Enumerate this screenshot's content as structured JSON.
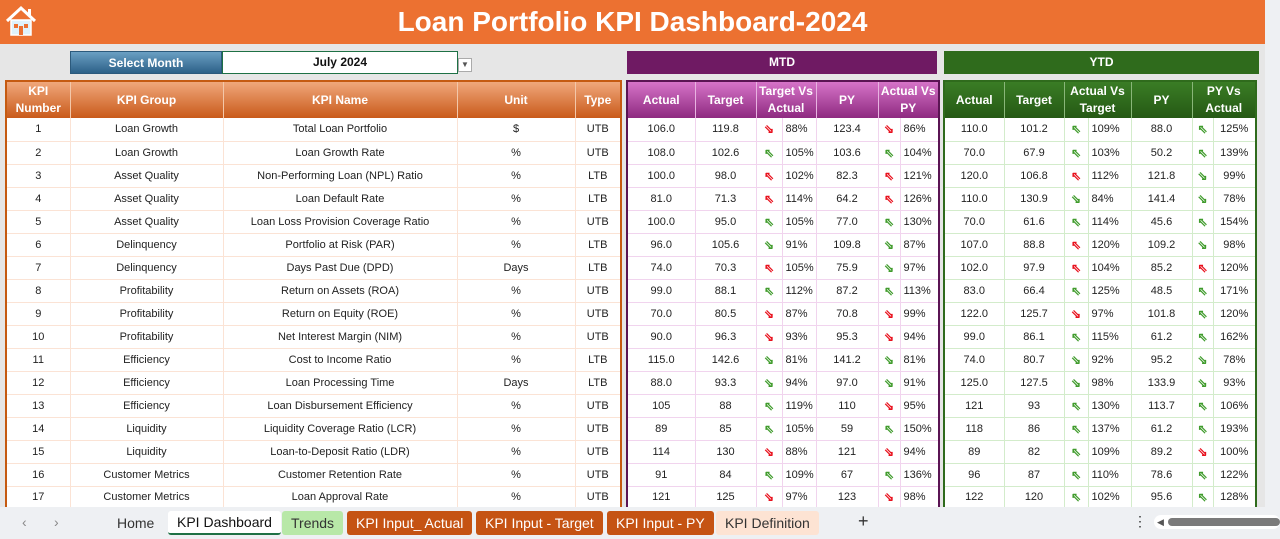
{
  "header": {
    "title": "Loan Portfolio KPI Dashboard-2024",
    "home_icon": "home-icon",
    "brand_color": "#ec7131"
  },
  "selector": {
    "label": "Select Month",
    "value": "July 2024",
    "dropdown_icon": "chevron-down-icon"
  },
  "sections": {
    "mtd": "MTD",
    "ytd": "YTD"
  },
  "kpi_columns": [
    "KPI Number",
    "KPI Group",
    "KPI Name",
    "Unit",
    "Type"
  ],
  "mtd_columns": [
    "Actual",
    "Target",
    "Target Vs Actual",
    "PY",
    "Actual Vs PY"
  ],
  "ytd_columns": [
    "Actual",
    "Target",
    "Actual Vs Target",
    "PY",
    "PY Vs Actual"
  ],
  "status_colors": {
    "good": "#3f9b2b",
    "bad": "#e8101c"
  },
  "rows": [
    {
      "num": "1",
      "group": "Loan Growth",
      "name": "Total Loan Portfolio",
      "unit": "$",
      "type": "UTB",
      "mtd": {
        "actual": "106.0",
        "target": "119.8",
        "tva_dir": "down",
        "tva_status": "bad",
        "tva": "88%",
        "py": "123.4",
        "avp_dir": "down",
        "avp_status": "bad",
        "avp": "86%"
      },
      "ytd": {
        "actual": "110.0",
        "target": "101.2",
        "avt_dir": "up",
        "avt_status": "good",
        "avt": "109%",
        "py": "88.0",
        "pva_dir": "up",
        "pva_status": "good",
        "pva": "125%"
      }
    },
    {
      "num": "2",
      "group": "Loan Growth",
      "name": "Loan Growth Rate",
      "unit": "%",
      "type": "UTB",
      "mtd": {
        "actual": "108.0",
        "target": "102.6",
        "tva_dir": "up",
        "tva_status": "good",
        "tva": "105%",
        "py": "103.6",
        "avp_dir": "up",
        "avp_status": "good",
        "avp": "104%"
      },
      "ytd": {
        "actual": "70.0",
        "target": "67.9",
        "avt_dir": "up",
        "avt_status": "good",
        "avt": "103%",
        "py": "50.2",
        "pva_dir": "up",
        "pva_status": "good",
        "pva": "139%"
      }
    },
    {
      "num": "3",
      "group": "Asset Quality",
      "name": "Non-Performing Loan (NPL) Ratio",
      "unit": "%",
      "type": "LTB",
      "mtd": {
        "actual": "100.0",
        "target": "98.0",
        "tva_dir": "up",
        "tva_status": "bad",
        "tva": "102%",
        "py": "82.3",
        "avp_dir": "up",
        "avp_status": "bad",
        "avp": "121%"
      },
      "ytd": {
        "actual": "120.0",
        "target": "106.8",
        "avt_dir": "up",
        "avt_status": "bad",
        "avt": "112%",
        "py": "121.8",
        "pva_dir": "down",
        "pva_status": "good",
        "pva": "99%"
      }
    },
    {
      "num": "4",
      "group": "Asset Quality",
      "name": "Loan Default Rate",
      "unit": "%",
      "type": "LTB",
      "mtd": {
        "actual": "81.0",
        "target": "71.3",
        "tva_dir": "up",
        "tva_status": "bad",
        "tva": "114%",
        "py": "64.2",
        "avp_dir": "up",
        "avp_status": "bad",
        "avp": "126%"
      },
      "ytd": {
        "actual": "110.0",
        "target": "130.9",
        "avt_dir": "down",
        "avt_status": "good",
        "avt": "84%",
        "py": "141.4",
        "pva_dir": "down",
        "pva_status": "good",
        "pva": "78%"
      }
    },
    {
      "num": "5",
      "group": "Asset Quality",
      "name": "Loan Loss Provision Coverage Ratio",
      "unit": "%",
      "type": "UTB",
      "mtd": {
        "actual": "100.0",
        "target": "95.0",
        "tva_dir": "up",
        "tva_status": "good",
        "tva": "105%",
        "py": "77.0",
        "avp_dir": "up",
        "avp_status": "good",
        "avp": "130%"
      },
      "ytd": {
        "actual": "70.0",
        "target": "61.6",
        "avt_dir": "up",
        "avt_status": "good",
        "avt": "114%",
        "py": "45.6",
        "pva_dir": "up",
        "pva_status": "good",
        "pva": "154%"
      }
    },
    {
      "num": "6",
      "group": "Delinquency",
      "name": "Portfolio at Risk (PAR)",
      "unit": "%",
      "type": "LTB",
      "mtd": {
        "actual": "96.0",
        "target": "105.6",
        "tva_dir": "down",
        "tva_status": "good",
        "tva": "91%",
        "py": "109.8",
        "avp_dir": "down",
        "avp_status": "good",
        "avp": "87%"
      },
      "ytd": {
        "actual": "107.0",
        "target": "88.8",
        "avt_dir": "up",
        "avt_status": "bad",
        "avt": "120%",
        "py": "109.2",
        "pva_dir": "down",
        "pva_status": "good",
        "pva": "98%"
      }
    },
    {
      "num": "7",
      "group": "Delinquency",
      "name": "Days Past Due (DPD)",
      "unit": "Days",
      "type": "LTB",
      "mtd": {
        "actual": "74.0",
        "target": "70.3",
        "tva_dir": "up",
        "tva_status": "bad",
        "tva": "105%",
        "py": "75.9",
        "avp_dir": "down",
        "avp_status": "good",
        "avp": "97%"
      },
      "ytd": {
        "actual": "102.0",
        "target": "97.9",
        "avt_dir": "up",
        "avt_status": "bad",
        "avt": "104%",
        "py": "85.2",
        "pva_dir": "up",
        "pva_status": "bad",
        "pva": "120%"
      }
    },
    {
      "num": "8",
      "group": "Profitability",
      "name": "Return on Assets (ROA)",
      "unit": "%",
      "type": "UTB",
      "mtd": {
        "actual": "99.0",
        "target": "88.1",
        "tva_dir": "up",
        "tva_status": "good",
        "tva": "112%",
        "py": "87.2",
        "avp_dir": "up",
        "avp_status": "good",
        "avp": "113%"
      },
      "ytd": {
        "actual": "83.0",
        "target": "66.4",
        "avt_dir": "up",
        "avt_status": "good",
        "avt": "125%",
        "py": "48.5",
        "pva_dir": "up",
        "pva_status": "good",
        "pva": "171%"
      }
    },
    {
      "num": "9",
      "group": "Profitability",
      "name": "Return on Equity (ROE)",
      "unit": "%",
      "type": "UTB",
      "mtd": {
        "actual": "70.0",
        "target": "80.5",
        "tva_dir": "down",
        "tva_status": "bad",
        "tva": "87%",
        "py": "70.8",
        "avp_dir": "down",
        "avp_status": "bad",
        "avp": "99%"
      },
      "ytd": {
        "actual": "122.0",
        "target": "125.7",
        "avt_dir": "down",
        "avt_status": "bad",
        "avt": "97%",
        "py": "101.8",
        "pva_dir": "up",
        "pva_status": "good",
        "pva": "120%"
      }
    },
    {
      "num": "10",
      "group": "Profitability",
      "name": "Net Interest Margin (NIM)",
      "unit": "%",
      "type": "UTB",
      "mtd": {
        "actual": "90.0",
        "target": "96.3",
        "tva_dir": "down",
        "tva_status": "bad",
        "tva": "93%",
        "py": "95.3",
        "avp_dir": "down",
        "avp_status": "bad",
        "avp": "94%"
      },
      "ytd": {
        "actual": "99.0",
        "target": "86.1",
        "avt_dir": "up",
        "avt_status": "good",
        "avt": "115%",
        "py": "61.2",
        "pva_dir": "up",
        "pva_status": "good",
        "pva": "162%"
      }
    },
    {
      "num": "11",
      "group": "Efficiency",
      "name": "Cost to Income Ratio",
      "unit": "%",
      "type": "LTB",
      "mtd": {
        "actual": "115.0",
        "target": "142.6",
        "tva_dir": "down",
        "tva_status": "good",
        "tva": "81%",
        "py": "141.2",
        "avp_dir": "down",
        "avp_status": "good",
        "avp": "81%"
      },
      "ytd": {
        "actual": "74.0",
        "target": "80.7",
        "avt_dir": "down",
        "avt_status": "good",
        "avt": "92%",
        "py": "95.2",
        "pva_dir": "down",
        "pva_status": "good",
        "pva": "78%"
      }
    },
    {
      "num": "12",
      "group": "Efficiency",
      "name": "Loan Processing Time",
      "unit": "Days",
      "type": "LTB",
      "mtd": {
        "actual": "88.0",
        "target": "93.3",
        "tva_dir": "down",
        "tva_status": "good",
        "tva": "94%",
        "py": "97.0",
        "avp_dir": "down",
        "avp_status": "good",
        "avp": "91%"
      },
      "ytd": {
        "actual": "125.0",
        "target": "127.5",
        "avt_dir": "down",
        "avt_status": "good",
        "avt": "98%",
        "py": "133.9",
        "pva_dir": "down",
        "pva_status": "good",
        "pva": "93%"
      }
    },
    {
      "num": "13",
      "group": "Efficiency",
      "name": "Loan Disbursement Efficiency",
      "unit": "%",
      "type": "UTB",
      "mtd": {
        "actual": "105",
        "target": "88",
        "tva_dir": "up",
        "tva_status": "good",
        "tva": "119%",
        "py": "110",
        "avp_dir": "down",
        "avp_status": "bad",
        "avp": "95%"
      },
      "ytd": {
        "actual": "121",
        "target": "93",
        "avt_dir": "up",
        "avt_status": "good",
        "avt": "130%",
        "py": "113.7",
        "pva_dir": "up",
        "pva_status": "good",
        "pva": "106%"
      }
    },
    {
      "num": "14",
      "group": "Liquidity",
      "name": "Liquidity Coverage Ratio (LCR)",
      "unit": "%",
      "type": "UTB",
      "mtd": {
        "actual": "89",
        "target": "85",
        "tva_dir": "up",
        "tva_status": "good",
        "tva": "105%",
        "py": "59",
        "avp_dir": "up",
        "avp_status": "good",
        "avp": "150%"
      },
      "ytd": {
        "actual": "118",
        "target": "86",
        "avt_dir": "up",
        "avt_status": "good",
        "avt": "137%",
        "py": "61.2",
        "pva_dir": "up",
        "pva_status": "good",
        "pva": "193%"
      }
    },
    {
      "num": "15",
      "group": "Liquidity",
      "name": "Loan-to-Deposit Ratio (LDR)",
      "unit": "%",
      "type": "UTB",
      "mtd": {
        "actual": "114",
        "target": "130",
        "tva_dir": "down",
        "tva_status": "bad",
        "tva": "88%",
        "py": "121",
        "avp_dir": "down",
        "avp_status": "bad",
        "avp": "94%"
      },
      "ytd": {
        "actual": "89",
        "target": "82",
        "avt_dir": "up",
        "avt_status": "good",
        "avt": "109%",
        "py": "89.2",
        "pva_dir": "down",
        "pva_status": "bad",
        "pva": "100%"
      }
    },
    {
      "num": "16",
      "group": "Customer Metrics",
      "name": "Customer Retention Rate",
      "unit": "%",
      "type": "UTB",
      "mtd": {
        "actual": "91",
        "target": "84",
        "tva_dir": "up",
        "tva_status": "good",
        "tva": "109%",
        "py": "67",
        "avp_dir": "up",
        "avp_status": "good",
        "avp": "136%"
      },
      "ytd": {
        "actual": "96",
        "target": "87",
        "avt_dir": "up",
        "avt_status": "good",
        "avt": "110%",
        "py": "78.6",
        "pva_dir": "up",
        "pva_status": "good",
        "pva": "122%"
      }
    },
    {
      "num": "17",
      "group": "Customer Metrics",
      "name": "Loan Approval Rate",
      "unit": "%",
      "type": "UTB",
      "mtd": {
        "actual": "121",
        "target": "125",
        "tva_dir": "down",
        "tva_status": "bad",
        "tva": "97%",
        "py": "123",
        "avp_dir": "down",
        "avp_status": "bad",
        "avp": "98%"
      },
      "ytd": {
        "actual": "122",
        "target": "120",
        "avt_dir": "up",
        "avt_status": "good",
        "avt": "102%",
        "py": "95.6",
        "pva_dir": "up",
        "pva_status": "good",
        "pva": "128%"
      }
    }
  ],
  "tabs": {
    "prev_icon": "chevron-left-icon",
    "next_icon": "chevron-right-icon",
    "items": [
      {
        "label": "Home"
      },
      {
        "label": "KPI Dashboard",
        "active": true
      },
      {
        "label": "Trends"
      },
      {
        "label": "KPI Input_ Actual"
      },
      {
        "label": "KPI Input - Target"
      },
      {
        "label": "KPI Input - PY"
      },
      {
        "label": "KPI Definition"
      }
    ],
    "add_icon": "+",
    "more_icon": "⋮"
  }
}
